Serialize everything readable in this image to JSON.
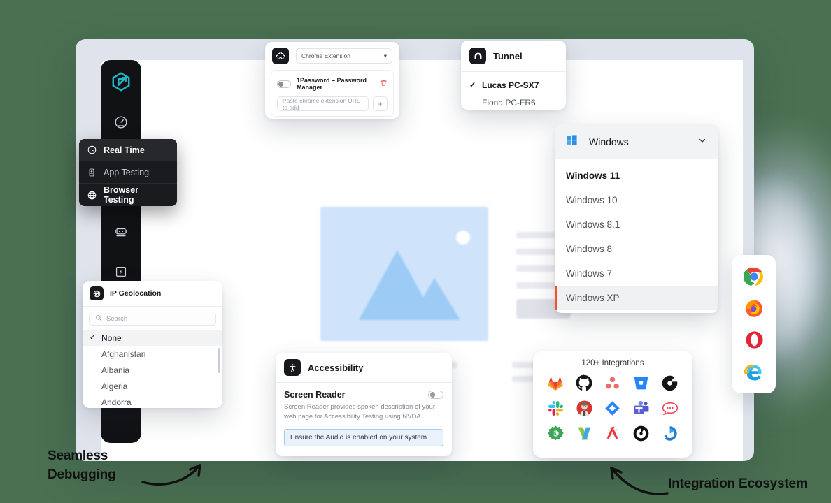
{
  "background_color": "#4a7051",
  "accent_colors": {
    "brand_teal": "#23b5c9",
    "highlight_orange": "#f4512c",
    "info_blue": "#e9f2fb"
  },
  "rail": {
    "logo_icon": "brand-hexagon-arrow-icon",
    "items": [
      {
        "icon": "speedometer-icon",
        "name": "dashboard"
      },
      {
        "icon": "device-frame-icon",
        "name": "real-device"
      },
      {
        "icon": "bolt-icon",
        "name": "automation"
      }
    ]
  },
  "real_time_menu": {
    "items": [
      {
        "label": "Real Time",
        "icon": "clock-icon",
        "active": true
      },
      {
        "label": "App Testing",
        "icon": "mobile-icon",
        "active": false
      },
      {
        "label": "Browser Testing",
        "icon": "globe-icon",
        "active": false
      }
    ]
  },
  "chrome_extension": {
    "icon": "puzzle-piece-icon",
    "select_value": "Chrome Extension",
    "extension_name": "1Password – Password Manager",
    "toggle_state": "off",
    "delete_icon": "trash-icon",
    "input_placeholder": "Paste chrome extension URL to add",
    "add_button_label": "+"
  },
  "tunnel": {
    "icon": "tunnel-icon",
    "title": "Tunnel",
    "items": [
      {
        "label": "Lucas PC-SX7",
        "selected": true
      },
      {
        "label": "Fiona PC-FR6",
        "selected": false
      }
    ]
  },
  "os_dropdown": {
    "icon": "windows-logo-icon",
    "selected_label": "Windows",
    "chevron_icon": "chevron-down-icon",
    "options": [
      {
        "label": "Windows 11",
        "bold": true,
        "highlighted": false
      },
      {
        "label": "Windows 10",
        "bold": false,
        "highlighted": false
      },
      {
        "label": "Windows 8.1",
        "bold": false,
        "highlighted": false
      },
      {
        "label": "Windows 8",
        "bold": false,
        "highlighted": false
      },
      {
        "label": "Windows 7",
        "bold": false,
        "highlighted": false
      },
      {
        "label": "Windows XP",
        "bold": false,
        "highlighted": true
      }
    ]
  },
  "ip_geolocation": {
    "icon": "globe-slash-icon",
    "title": "IP Geolocation",
    "search_placeholder": "Search",
    "search_icon": "search-icon",
    "options": [
      {
        "label": "None",
        "selected": true
      },
      {
        "label": "Afghanistan",
        "selected": false
      },
      {
        "label": "Albania",
        "selected": false
      },
      {
        "label": "Algeria",
        "selected": false
      },
      {
        "label": "Andorra",
        "selected": false
      }
    ]
  },
  "accessibility": {
    "icon": "accessibility-person-icon",
    "title": "Accessibility",
    "section_label": "Screen Reader",
    "toggle_state": "off",
    "description": "Screen Reader provides spoken description of your web page for Accessibility Testing using NVDA",
    "note": "Ensure the Audio is enabled on your system"
  },
  "integrations": {
    "title": "120+ Integrations",
    "logos": [
      "gitlab-icon",
      "github-icon",
      "asana-icon",
      "bitbucket-icon",
      "circleci-icon",
      "slack-icon",
      "jenkins-icon",
      "jira-icon",
      "microsoft-teams-icon",
      "rocketchat-icon",
      "kualitee-icon",
      "klaros-icon",
      "testrail-icon",
      "mantis-icon",
      "zephyr-icon"
    ]
  },
  "browsers": {
    "items": [
      "chrome-icon",
      "firefox-icon",
      "opera-icon",
      "internet-explorer-icon"
    ]
  },
  "annotations": {
    "left_line1": "Seamless",
    "left_line2": "Debugging",
    "right": "Integration Ecosystem"
  }
}
